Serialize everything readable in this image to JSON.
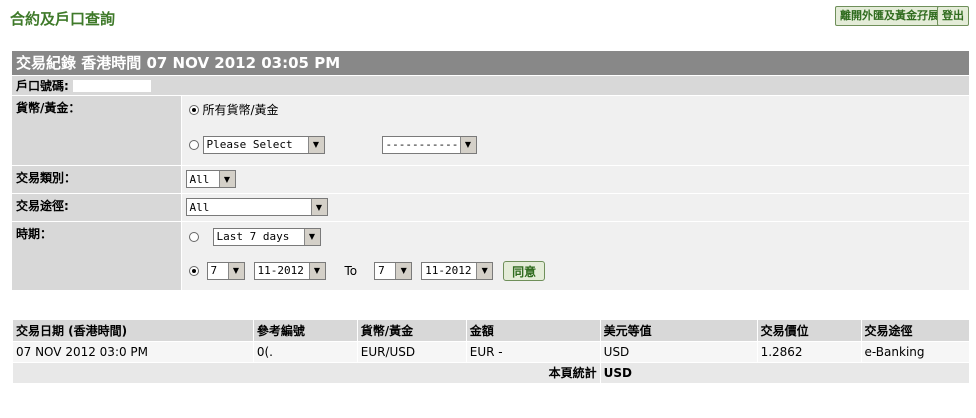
{
  "page": {
    "title": "合約及戶口查詢",
    "leave_button": "離開外匯及黃金孖展",
    "logout_button": "登出"
  },
  "section": {
    "title": "交易紀錄  香港時間 07 NOV 2012 03:05 PM"
  },
  "filters": {
    "account_label": "戶口號碼:",
    "currency_label": "貨幣/黃金：",
    "currency_all_option": "所有貨幣/黃金",
    "currency_select_1": "Please Select",
    "currency_select_2": "-----------",
    "trade_type_label": "交易類別：",
    "trade_type_value": "All",
    "channel_label": "交易途徑:",
    "channel_value": "All",
    "period_label": "時期：",
    "period_preset": "Last 7 days",
    "from_day": "7",
    "from_month": "11-2012",
    "to_label": "To",
    "to_day": "7",
    "to_month": "11-2012",
    "agree_button": "同意"
  },
  "results": {
    "columns": [
      "交易日期 (香港時間)",
      "參考編號",
      "貨幣/黃金",
      "金額",
      "美元等值",
      "交易價位",
      "交易途徑"
    ],
    "rows": [
      {
        "date": "07 NOV 2012 03:0   PM",
        "ref": "0(.",
        "currency": "EUR/USD",
        "amount": "EUR -",
        "usd_equiv": "USD",
        "rate": "1.2862",
        "channel": "e-Banking"
      }
    ],
    "total_label": "本頁統計",
    "total_value": "USD"
  }
}
